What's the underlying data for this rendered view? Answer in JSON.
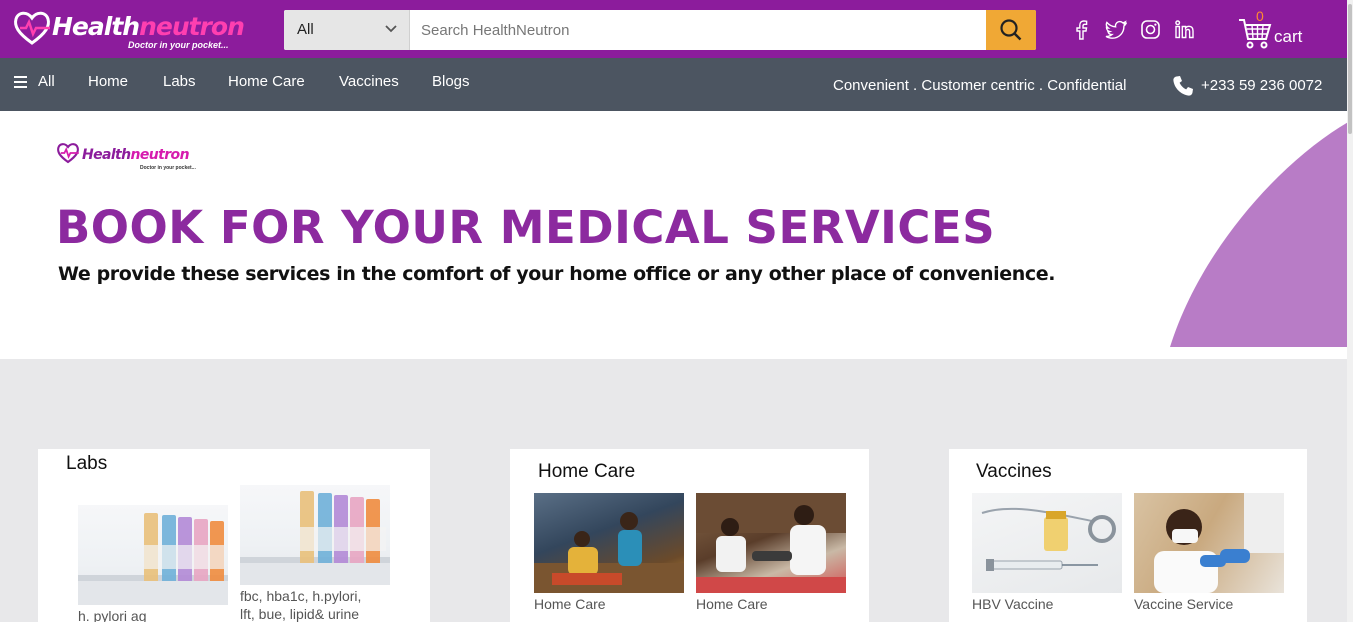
{
  "brand": {
    "name_part1": "Health",
    "name_part2": "neutron",
    "tagline": "Doctor in your pocket...",
    "primary_color": "#8c1c9c",
    "accent_color": "#ff3fb0"
  },
  "search": {
    "category": "All",
    "placeholder": "Search HealthNeutron",
    "button_icon": "search-icon"
  },
  "social": [
    "facebook-icon",
    "twitter-icon",
    "instagram-icon",
    "linkedin-icon"
  ],
  "cart": {
    "count": "0",
    "label": "cart"
  },
  "nav": {
    "all_label": "All",
    "links": [
      "Home",
      "Labs",
      "Home Care",
      "Vaccines",
      "Blogs"
    ],
    "tagline": "Convenient . Customer centric . Confidential",
    "phone": "+233 59 236 0072"
  },
  "hero": {
    "title": "BOOK FOR YOUR MEDICAL SERVICES",
    "subtitle": "We provide these services in the comfort of your home office or any other place of convenience."
  },
  "cards": [
    {
      "title": "Labs",
      "items": [
        {
          "caption_lines": [
            "h. pylori ag"
          ]
        },
        {
          "caption_lines": [
            "fbc, hba1c, h.pylori,",
            "lft, bue, lipid& urine"
          ]
        }
      ]
    },
    {
      "title": "Home Care",
      "items": [
        {
          "caption_lines": [
            "Home Care"
          ]
        },
        {
          "caption_lines": [
            "Home Care"
          ]
        }
      ]
    },
    {
      "title": "Vaccines",
      "items": [
        {
          "caption_lines": [
            "HBV Vaccine"
          ]
        },
        {
          "caption_lines": [
            "Vaccine Service"
          ]
        }
      ]
    }
  ]
}
